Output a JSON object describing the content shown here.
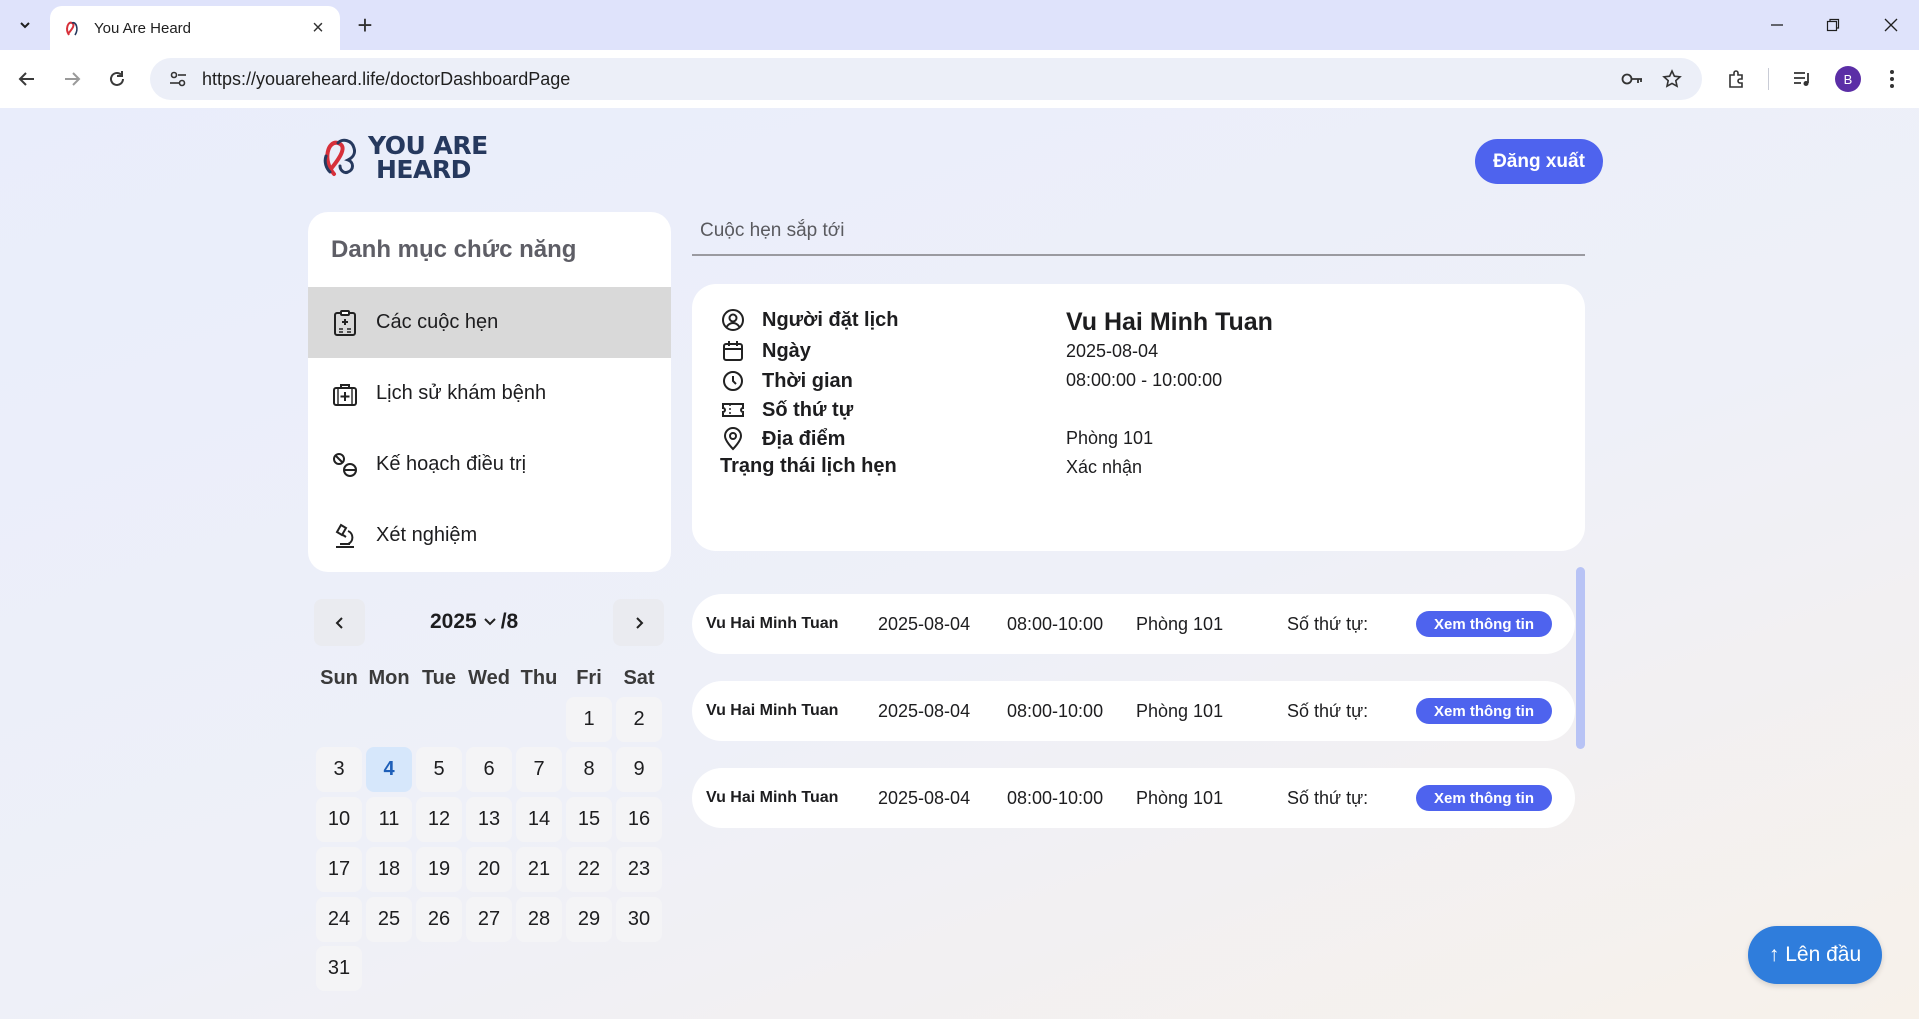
{
  "browser": {
    "tab_title": "You Are Heard",
    "url_host": "https://youareheard.life",
    "url_path": "/doctorDashboardPage",
    "profile_initial": "B"
  },
  "header": {
    "logo_line1": "YOU ARE",
    "logo_line2": "HEARD",
    "logout_label": "Đăng xuất"
  },
  "menu": {
    "title": "Danh mục chức năng",
    "items": [
      {
        "label": "Các cuộc hẹn",
        "icon": "hospital-clipboard-icon",
        "active": true
      },
      {
        "label": "Lịch sử khám bệnh",
        "icon": "medical-bag-icon",
        "active": false
      },
      {
        "label": "Kế hoạch điều trị",
        "icon": "pills-icon",
        "active": false
      },
      {
        "label": "Xét nghiệm",
        "icon": "microscope-icon",
        "active": false
      }
    ]
  },
  "calendar": {
    "year": "2025",
    "month_suffix": "/8",
    "weekdays": [
      "Sun",
      "Mon",
      "Tue",
      "Wed",
      "Thu",
      "Fri",
      "Sat"
    ],
    "first_weekday_index": 5,
    "days_in_month": 31,
    "selected_day": 4
  },
  "upcoming": {
    "title": "Cuộc hẹn sắp tới",
    "detail": {
      "booker_label": "Người đặt lịch",
      "booker_value": "Vu Hai Minh Tuan",
      "date_label": "Ngày",
      "date_value": "2025-08-04",
      "time_label": "Thời gian",
      "time_value": "08:00:00 - 10:00:00",
      "queue_label": "Số thứ tự",
      "queue_value": "",
      "location_label": "Địa điểm",
      "location_value": "Phòng 101",
      "status_label": "Trạng thái lịch hẹn",
      "status_value": "Xác nhận"
    },
    "list": [
      {
        "name": "Vu Hai Minh Tuan",
        "date": "2025-08-04",
        "time": "08:00-10:00",
        "room": "Phòng 101",
        "queue": "Số thứ tự:",
        "button": "Xem thông tin"
      },
      {
        "name": "Vu Hai Minh Tuan",
        "date": "2025-08-04",
        "time": "08:00-10:00",
        "room": "Phòng 101",
        "queue": "Số thứ tự:",
        "button": "Xem thông tin"
      },
      {
        "name": "Vu Hai Minh Tuan",
        "date": "2025-08-04",
        "time": "08:00-10:00",
        "room": "Phòng 101",
        "queue": "Số thứ tự:",
        "button": "Xem thông tin"
      }
    ]
  },
  "to_top_label": "↑ Lên đầu",
  "colors": {
    "accent": "#4e63ee",
    "to_top": "#2f7ddc",
    "logo_text": "#26395e",
    "today_bg": "#d6e7fb"
  }
}
